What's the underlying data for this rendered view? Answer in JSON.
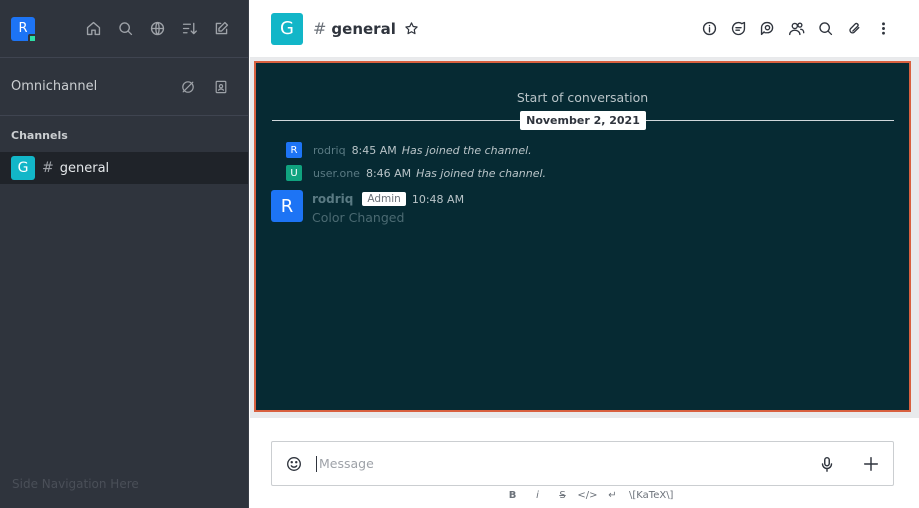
{
  "sidebar": {
    "user_initial": "R",
    "omnichannel_label": "Omnichannel",
    "section_title": "Channels",
    "rooms": [
      {
        "initial": "G",
        "name": "general"
      }
    ],
    "footer_text": "Side Navigation Here"
  },
  "header": {
    "room_initial": "G",
    "room_name": "general"
  },
  "conversation": {
    "start_text": "Start of conversation",
    "date_divider": "November 2, 2021",
    "system_messages": [
      {
        "initial": "R",
        "user": "rodriq",
        "time": "8:45 AM",
        "text": "Has joined the channel.",
        "color": "#1d74f5"
      },
      {
        "initial": "U",
        "user": "user.one",
        "time": "8:46 AM",
        "text": "Has joined the channel.",
        "color": "#10a37f"
      }
    ],
    "message": {
      "initial": "R",
      "user": "rodriq",
      "role": "Admin",
      "time": "10:48 AM",
      "text": "Color Changed"
    }
  },
  "composer": {
    "placeholder": "Message",
    "format_buttons": [
      "B",
      "i",
      "S",
      "</>",
      "↵",
      "\\[KaTeX\\]"
    ]
  },
  "colors": {
    "sidebar_bg": "#2f343d",
    "message_bg": "#062a33",
    "frame_border": "#d8603f",
    "room_avatar": "#12b6c8",
    "user_avatar": "#1d74f5"
  },
  "icons": {
    "sidebar_actions": [
      "home-icon",
      "search-icon",
      "directory-globe-icon",
      "sort-icon",
      "create-new-icon"
    ],
    "omnichannel_actions": [
      "omnichannel-status-icon",
      "contact-center-icon"
    ],
    "header_actions": [
      "info-icon",
      "threads-icon",
      "discussions-icon",
      "members-icon",
      "search-messages-icon",
      "files-icon",
      "kebab-menu-icon"
    ]
  }
}
